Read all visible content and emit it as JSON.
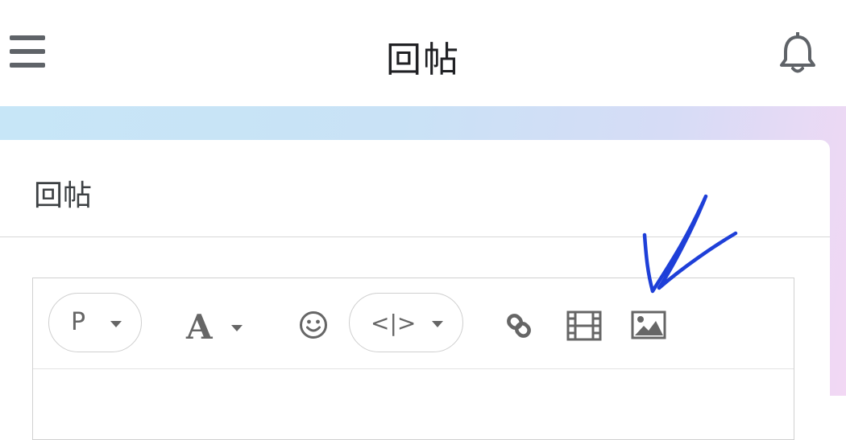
{
  "header": {
    "title": "回帖",
    "menu_icon": "hamburger-menu-icon",
    "notification_icon": "bell-icon"
  },
  "card": {
    "title": "回帖"
  },
  "toolbar": {
    "paragraph_format": "P",
    "font_style": "A",
    "code_label": "<|>",
    "icons": [
      "paragraph-dropdown",
      "font-dropdown",
      "emoji-icon",
      "code-dropdown",
      "link-icon",
      "video-icon",
      "image-icon"
    ]
  },
  "annotation": {
    "type": "hand-drawn-checkmark",
    "color": "#1e3fd8"
  },
  "colors": {
    "icon_gray": "#666666",
    "title_text": "#202124",
    "banner_gradient_start": "#c7e6f7",
    "banner_gradient_end": "#f2d8f4"
  }
}
